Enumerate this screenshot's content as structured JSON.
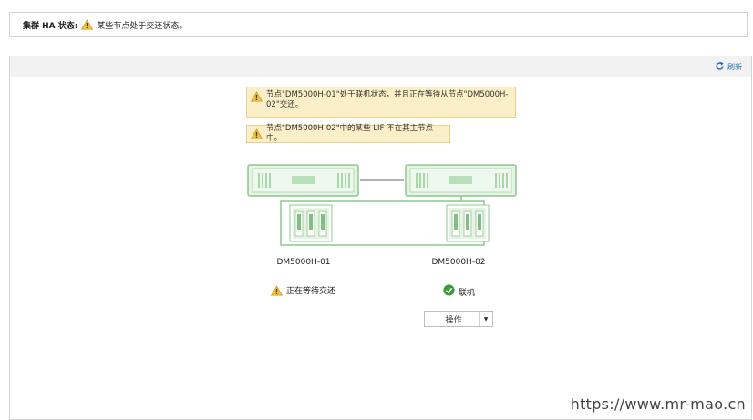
{
  "status_bar": {
    "label": "集群 HA 状态:",
    "message": "某些节点处于交还状态。"
  },
  "panel": {
    "refresh_label": "刷新"
  },
  "alerts": [
    "节点\"DM5000H-01\"处于联机状态，并且正在等待从节点\"DM5000H-02\"交还。",
    "节点\"DM5000H-02\"中的某些 LIF 不在其主节点中。"
  ],
  "nodes": [
    {
      "name": "DM5000H-01",
      "status": "正在等待交还",
      "status_icon": "warning-icon"
    },
    {
      "name": "DM5000H-02",
      "status": "联机",
      "status_icon": "check-circle-icon"
    }
  ],
  "action_button": {
    "label": "操作"
  },
  "watermark": "https://www.mr-mao.cn",
  "colors": {
    "warning": "#e8b321",
    "ok": "#3a9a3a",
    "device_fill": "#dff0df",
    "device_stroke": "#8cc88c",
    "link": "#2a6fb8"
  }
}
